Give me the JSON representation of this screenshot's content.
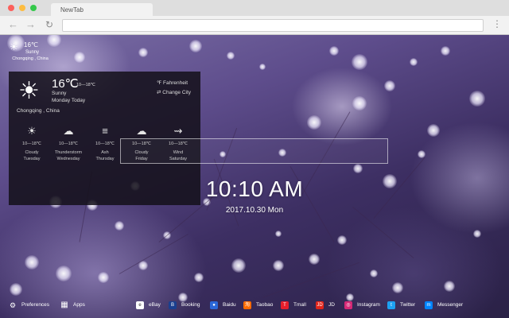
{
  "browser": {
    "tab_title": "NewTab",
    "back_icon": "←",
    "forward_icon": "→",
    "reload_icon": "↻",
    "menu_icon": "⋮"
  },
  "mini_weather": {
    "icon": "☀",
    "temp": "16℃",
    "condition": "Sunny",
    "location": "Chongqing , China"
  },
  "weather": {
    "icon": "☀",
    "temp": "16℃",
    "range": "10—18℃",
    "condition": "Sunny",
    "day": "Monday Today",
    "unit_icon": "℉",
    "unit_label": "Fahrenheit",
    "change_icon": "⇄",
    "change_label": "Change City",
    "city": "Chongqing , China",
    "forecast": [
      {
        "icon": "☀",
        "range": "10—18℃",
        "condition": "Cloudy",
        "day": "Tuesday"
      },
      {
        "icon": "☁",
        "range": "10—18℃",
        "condition": "Thunderstorm",
        "day": "Wednesday"
      },
      {
        "icon": "≡",
        "range": "10—18℃",
        "condition": "Ash",
        "day": "Thursday"
      },
      {
        "icon": "☁",
        "range": "10—18℃",
        "condition": "Cloudy",
        "day": "Friday"
      },
      {
        "icon": "⇝",
        "range": "10—18℃",
        "condition": "Wind",
        "day": "Saturday"
      }
    ]
  },
  "clock": {
    "time": "10:10 AM",
    "date": "2017.10.30 Mon"
  },
  "bottom_bar": {
    "preferences": {
      "icon": "⚙",
      "label": "Preferences"
    },
    "apps": {
      "icon": "▦",
      "label": "Apps"
    },
    "links": [
      {
        "label": "eBay",
        "color": "#ffffff",
        "glyph": "e"
      },
      {
        "label": "Booking",
        "color": "#1a3f8f",
        "glyph": "B"
      },
      {
        "label": "Baidu",
        "color": "#2b67d8",
        "glyph": "●"
      },
      {
        "label": "Taobao",
        "color": "#ff6a00",
        "glyph": "淘"
      },
      {
        "label": "Tmall",
        "color": "#e61e2b",
        "glyph": "T"
      },
      {
        "label": "JD",
        "color": "#e1251b",
        "glyph": "JD"
      },
      {
        "label": "Instagram",
        "color": "#d62976",
        "glyph": "◎"
      },
      {
        "label": "Twitter",
        "color": "#1da1f2",
        "glyph": "t"
      },
      {
        "label": "Messenger",
        "color": "#0084ff",
        "glyph": "m"
      }
    ]
  }
}
